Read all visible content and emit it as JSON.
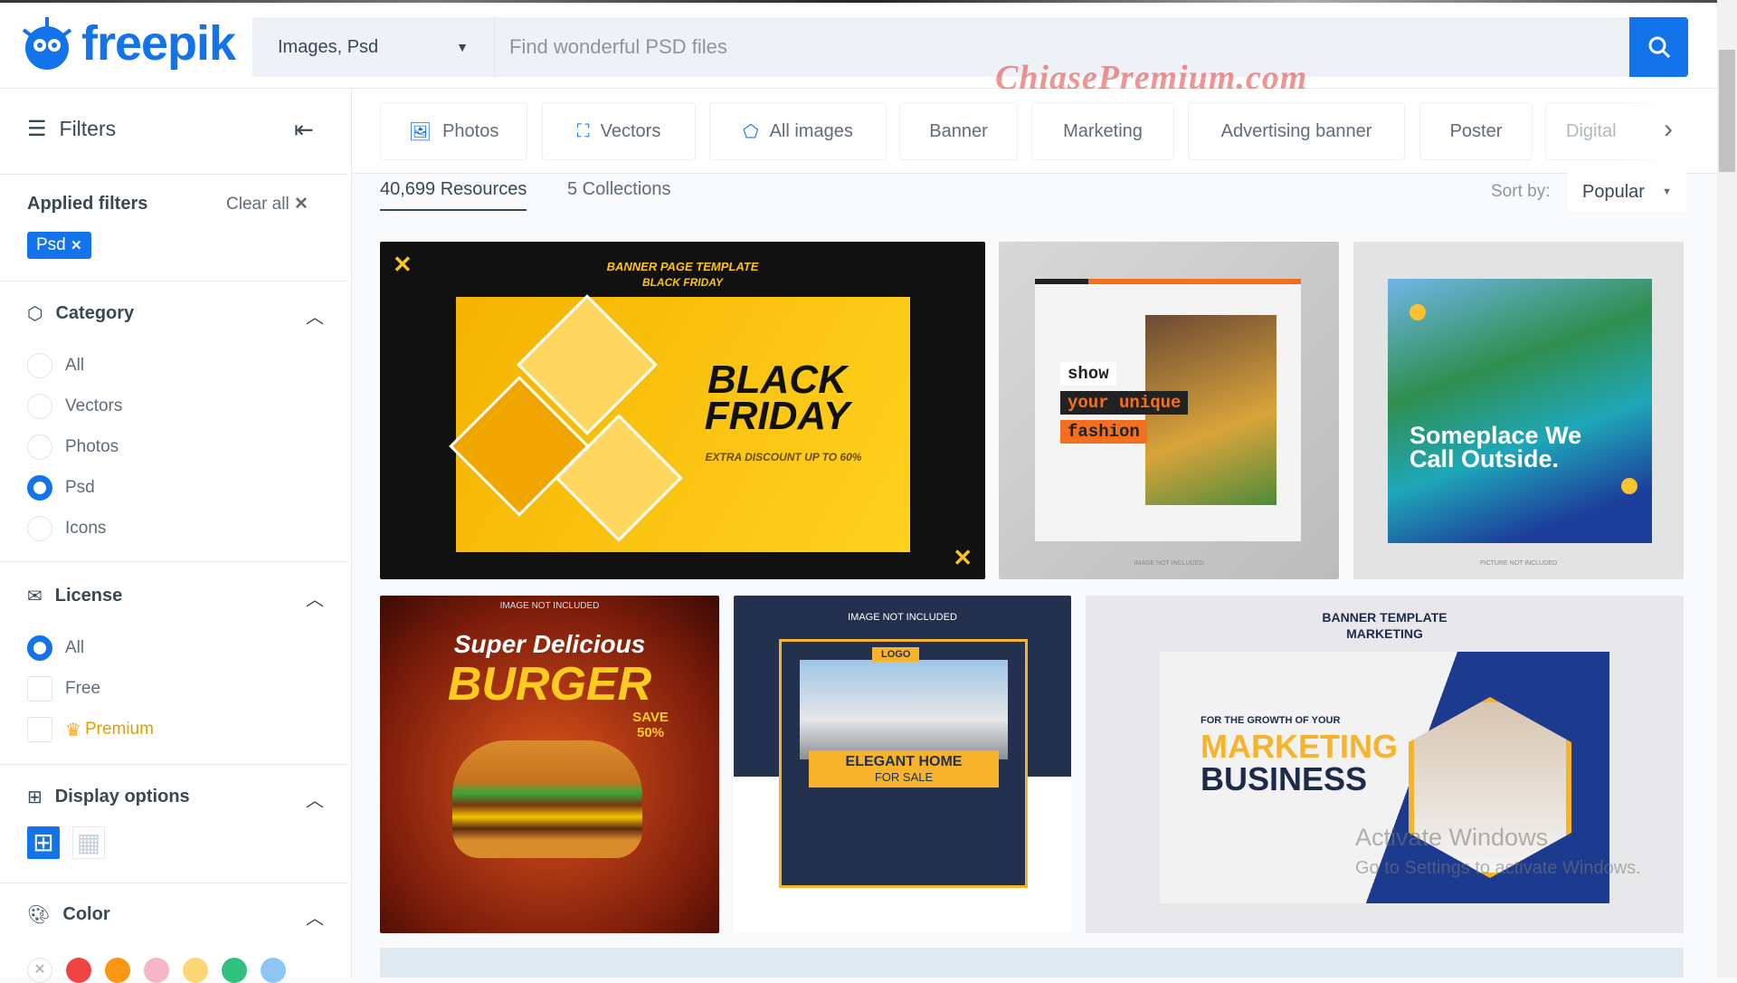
{
  "header": {
    "logo": "freepik",
    "search_type": "Images, Psd",
    "search_placeholder": "Find wonderful PSD files",
    "watermark": "ChiasePremium.com"
  },
  "sidebar": {
    "title": "Filters",
    "applied_filters": "Applied filters",
    "clear_all": "Clear all",
    "chip": "Psd",
    "category": {
      "title": "Category",
      "options": [
        {
          "label": "All",
          "selected": false
        },
        {
          "label": "Vectors",
          "selected": false
        },
        {
          "label": "Photos",
          "selected": false
        },
        {
          "label": "Psd",
          "selected": true
        },
        {
          "label": "Icons",
          "selected": false
        }
      ]
    },
    "license": {
      "title": "License",
      "options": [
        {
          "label": "All",
          "selected": true
        },
        {
          "label": "Free",
          "selected": false
        },
        {
          "label": "Premium",
          "selected": false
        }
      ]
    },
    "display": {
      "title": "Display options"
    },
    "color": {
      "title": "Color",
      "swatches": [
        "#f04343",
        "#fb9514",
        "#f7b6c5",
        "#fbd775",
        "#30c17f",
        "#8ec5f5"
      ]
    }
  },
  "tabs": [
    {
      "label": "Photos",
      "icon": "image-icon"
    },
    {
      "label": "Vectors",
      "icon": "vector-icon"
    },
    {
      "label": "All images",
      "icon": "shapes-icon"
    },
    {
      "label": "Banner"
    },
    {
      "label": "Marketing"
    },
    {
      "label": "Advertising banner"
    },
    {
      "label": "Poster"
    },
    {
      "label": "Digital"
    }
  ],
  "results": {
    "resources": "40,699 Resources",
    "collections": "5 Collections",
    "sort_label": "Sort by:",
    "sort_value": "Popular"
  },
  "images": [
    {
      "title": "BANNER PAGE TEMPLATE",
      "subtitle": "BLACK FRIDAY",
      "text": "BLACK FRIDAY",
      "extra": "EXTRA DISCOUNT UP TO 60%"
    },
    {
      "text1": "show",
      "text2": "your unique",
      "text3": "fashion",
      "foot": "IMAGE NOT INCLUDED"
    },
    {
      "text": "Someplace We Call Outside.",
      "foot": "PICTURE NOT INCLUDED"
    },
    {
      "top": "IMAGE NOT INCLUDED",
      "text1": "Super Delicious",
      "text2": "BURGER",
      "badge": "SAVE 50%"
    },
    {
      "top": "IMAGE NOT INCLUDED",
      "logo": "LOGO",
      "text1": "ELEGANT HOME",
      "text2": "FOR SALE"
    },
    {
      "title": "BANNER TEMPLATE",
      "subtitle": "MARKETING",
      "text1": "FOR THE GROWTH OF YOUR",
      "text2": "MARKETING",
      "text3": "BUSINESS"
    }
  ],
  "os_overlay": {
    "line1": "Activate Windows",
    "line2": "Go to Settings to activate Windows."
  }
}
